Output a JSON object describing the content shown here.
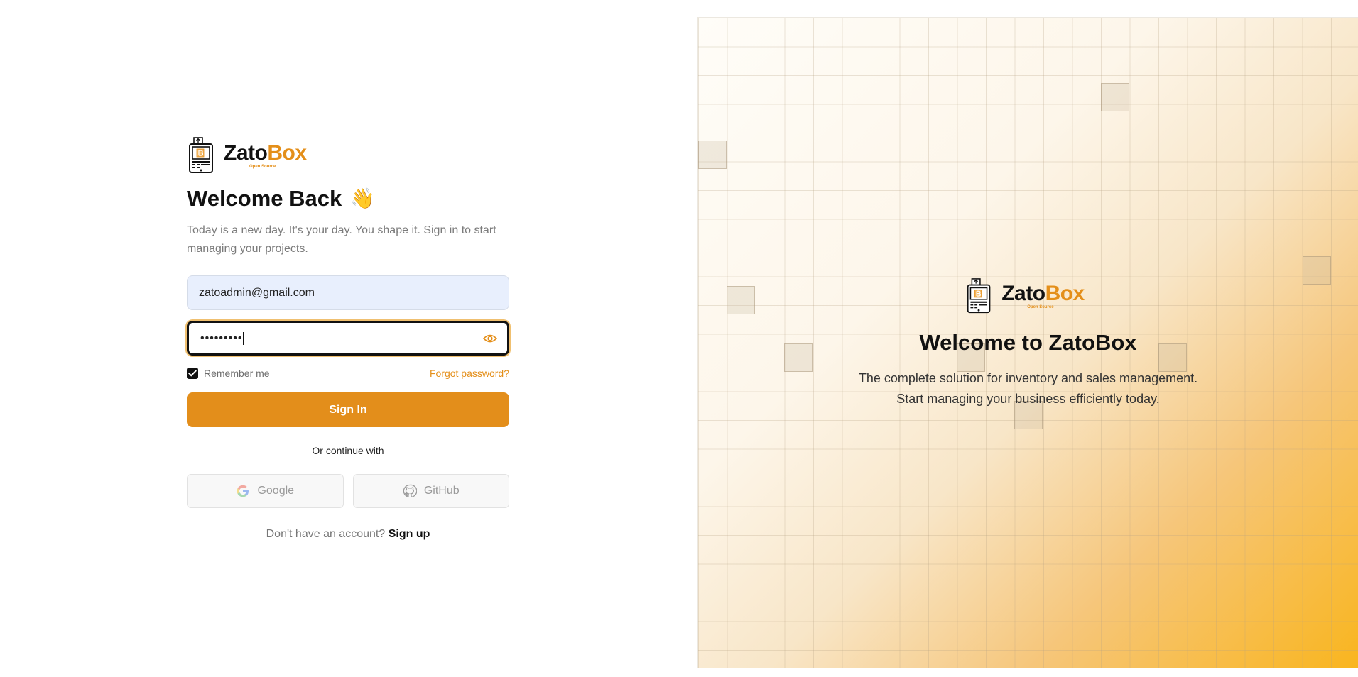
{
  "brand": {
    "name_part1": "Zato",
    "name_part2": "Box",
    "tagline": "Open Source"
  },
  "login": {
    "title": "Welcome Back",
    "wave_emoji": "👋",
    "subtitle": "Today is a new day. It's your day. You shape it. Sign in to start managing your projects.",
    "email_value": "zatoadmin@gmail.com",
    "password_mask": "•••••••••",
    "remember_label": "Remember me",
    "remember_checked": true,
    "forgot_label": "Forgot password?",
    "signin_label": "Sign In",
    "divider_label": "Or continue with",
    "google_label": "Google",
    "github_label": "GitHub",
    "no_account_text": "Don't have an account?",
    "signup_label": "Sign up"
  },
  "promo": {
    "title": "Welcome to ZatoBox",
    "line1": "The complete solution for inventory and sales management.",
    "line2": "Start managing your business efficiently today."
  },
  "colors": {
    "accent": "#e38e1b",
    "email_bg": "#e8effd",
    "gradient_end": "#f9b51e"
  },
  "icons": {
    "logo": "cash-register-icon",
    "eye": "eye-icon",
    "google": "google-icon",
    "github": "github-icon",
    "check": "checkbox-check-icon"
  }
}
